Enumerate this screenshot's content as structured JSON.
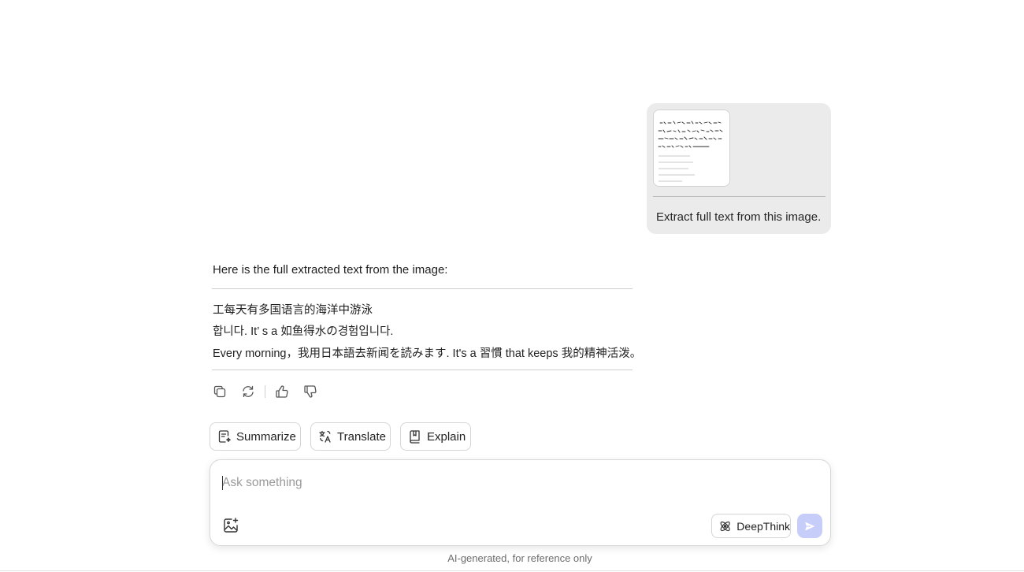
{
  "user_message": {
    "attachment_icon": "image-thumbnail",
    "text": "Extract full text from this image."
  },
  "assistant_reply": {
    "intro": "Here is the full extracted text from the image:",
    "lines": [
      "工每天有多国语言的海洋中游泳",
      "합니다. It’ s a 如鱼得水の경험입니다.",
      "Every morning，我用日本語去新闻を読みます. It's a 習慣 that keeps 我的精神活泼。"
    ]
  },
  "message_actions": {
    "icons": [
      "copy-icon",
      "regenerate-icon",
      "thumbs-up-icon",
      "thumbs-down-icon"
    ]
  },
  "quick_actions": [
    {
      "label": "Summarize",
      "icon": "summarize-icon"
    },
    {
      "label": "Translate",
      "icon": "translate-icon"
    },
    {
      "label": "Explain",
      "icon": "book-icon"
    }
  ],
  "composer": {
    "placeholder": "Ask something",
    "value": "",
    "deepthink_label": "DeepThink",
    "upload_icon": "image-upload-icon",
    "send_icon": "send-icon"
  },
  "footer": {
    "disclaimer": "AI-generated, for reference only"
  },
  "colors": {
    "user_bubble": "#ebebeb",
    "send_button": "#c7cdf9"
  }
}
